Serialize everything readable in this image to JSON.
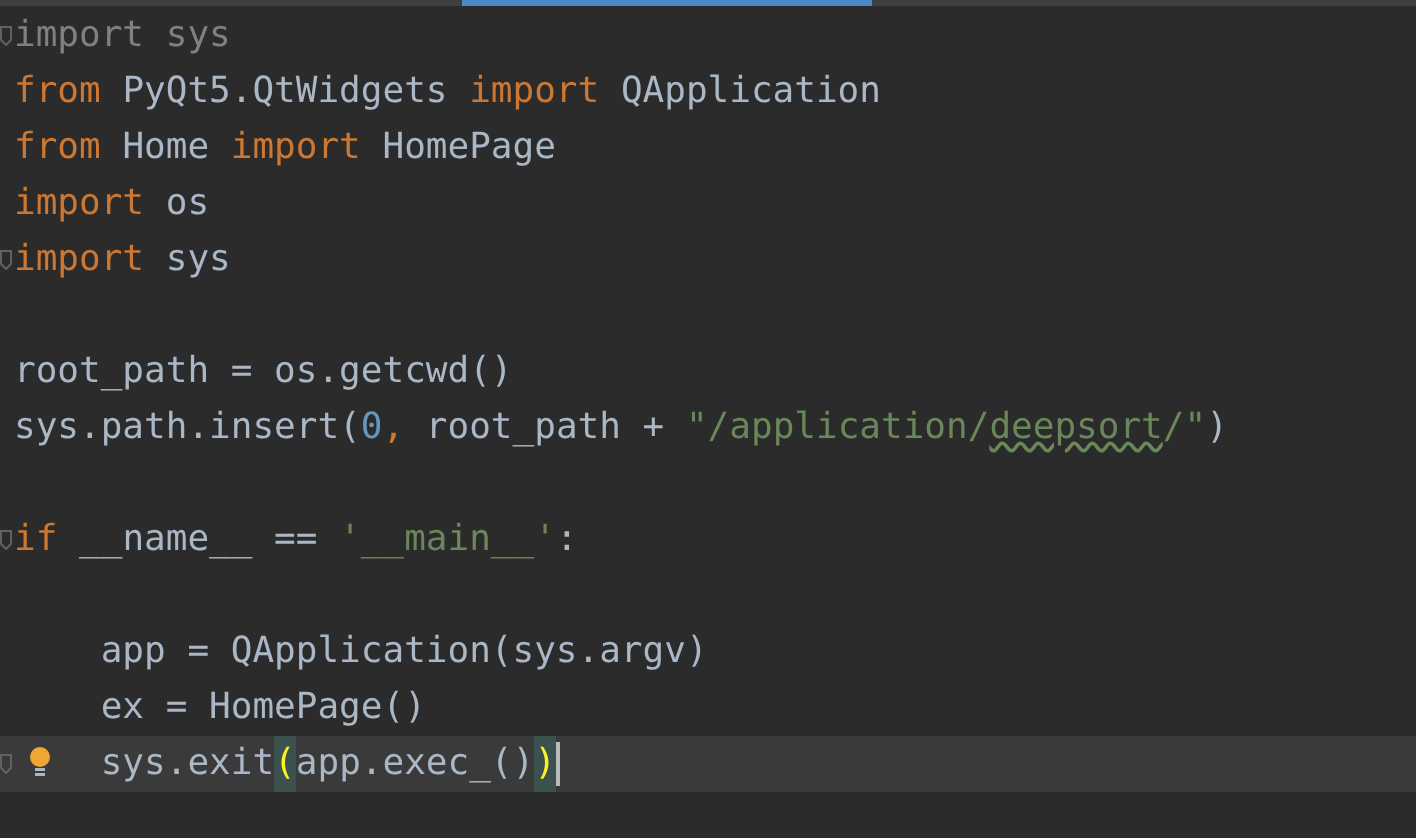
{
  "editor": {
    "lines": [
      {
        "fold": true,
        "current": false,
        "tokens": [
          {
            "kind": "unused",
            "text": "import sys"
          }
        ]
      },
      {
        "fold": false,
        "current": false,
        "tokens": [
          {
            "kind": "keyword",
            "text": "from "
          },
          {
            "kind": "plain",
            "text": "PyQt5.QtWidgets "
          },
          {
            "kind": "keyword",
            "text": "import "
          },
          {
            "kind": "plain",
            "text": "QApplication"
          }
        ]
      },
      {
        "fold": false,
        "current": false,
        "tokens": [
          {
            "kind": "keyword",
            "text": "from "
          },
          {
            "kind": "plain",
            "text": "Home "
          },
          {
            "kind": "keyword",
            "text": "import "
          },
          {
            "kind": "plain",
            "text": "HomePage"
          }
        ]
      },
      {
        "fold": false,
        "current": false,
        "tokens": [
          {
            "kind": "keyword",
            "text": "import "
          },
          {
            "kind": "plain",
            "text": "os"
          }
        ]
      },
      {
        "fold": true,
        "current": false,
        "tokens": [
          {
            "kind": "keyword",
            "text": "import "
          },
          {
            "kind": "plain",
            "text": "sys"
          }
        ]
      },
      {
        "fold": false,
        "current": false
      },
      {
        "fold": false,
        "current": false,
        "tokens": [
          {
            "kind": "plain",
            "text": "root_path = os.getcwd()"
          }
        ]
      },
      {
        "fold": false,
        "current": false,
        "tokens": [
          {
            "kind": "plain",
            "text": "sys.path.insert("
          },
          {
            "kind": "number",
            "text": "0"
          },
          {
            "kind": "keyword",
            "text": ", "
          },
          {
            "kind": "plain",
            "text": "root_path + "
          },
          {
            "kind": "string",
            "text": "\"/application/"
          },
          {
            "kind": "typo",
            "text": "deepsort"
          },
          {
            "kind": "string",
            "text": "/\""
          },
          {
            "kind": "plain",
            "text": ")"
          }
        ]
      },
      {
        "fold": false,
        "current": false
      },
      {
        "fold": true,
        "current": false,
        "tokens": [
          {
            "kind": "keyword",
            "text": "if "
          },
          {
            "kind": "plain",
            "text": "__name__ == "
          },
          {
            "kind": "string",
            "text": "'__main__'"
          },
          {
            "kind": "plain",
            "text": ":"
          }
        ]
      },
      {
        "fold": false,
        "current": false
      },
      {
        "fold": false,
        "current": false,
        "tokens": [
          {
            "kind": "plain",
            "text": "    app = QApplication(sys.argv)"
          }
        ]
      },
      {
        "fold": false,
        "current": false,
        "tokens": [
          {
            "kind": "plain",
            "text": "    ex = HomePage()"
          }
        ]
      },
      {
        "fold": true,
        "current": true,
        "intention": true,
        "caret": true,
        "tokens": [
          {
            "kind": "plain",
            "text": "    sys.exit"
          },
          {
            "kind": "match",
            "text": "("
          },
          {
            "kind": "plain",
            "text": "app.exec_()"
          },
          {
            "kind": "match",
            "text": ")"
          }
        ]
      }
    ]
  }
}
